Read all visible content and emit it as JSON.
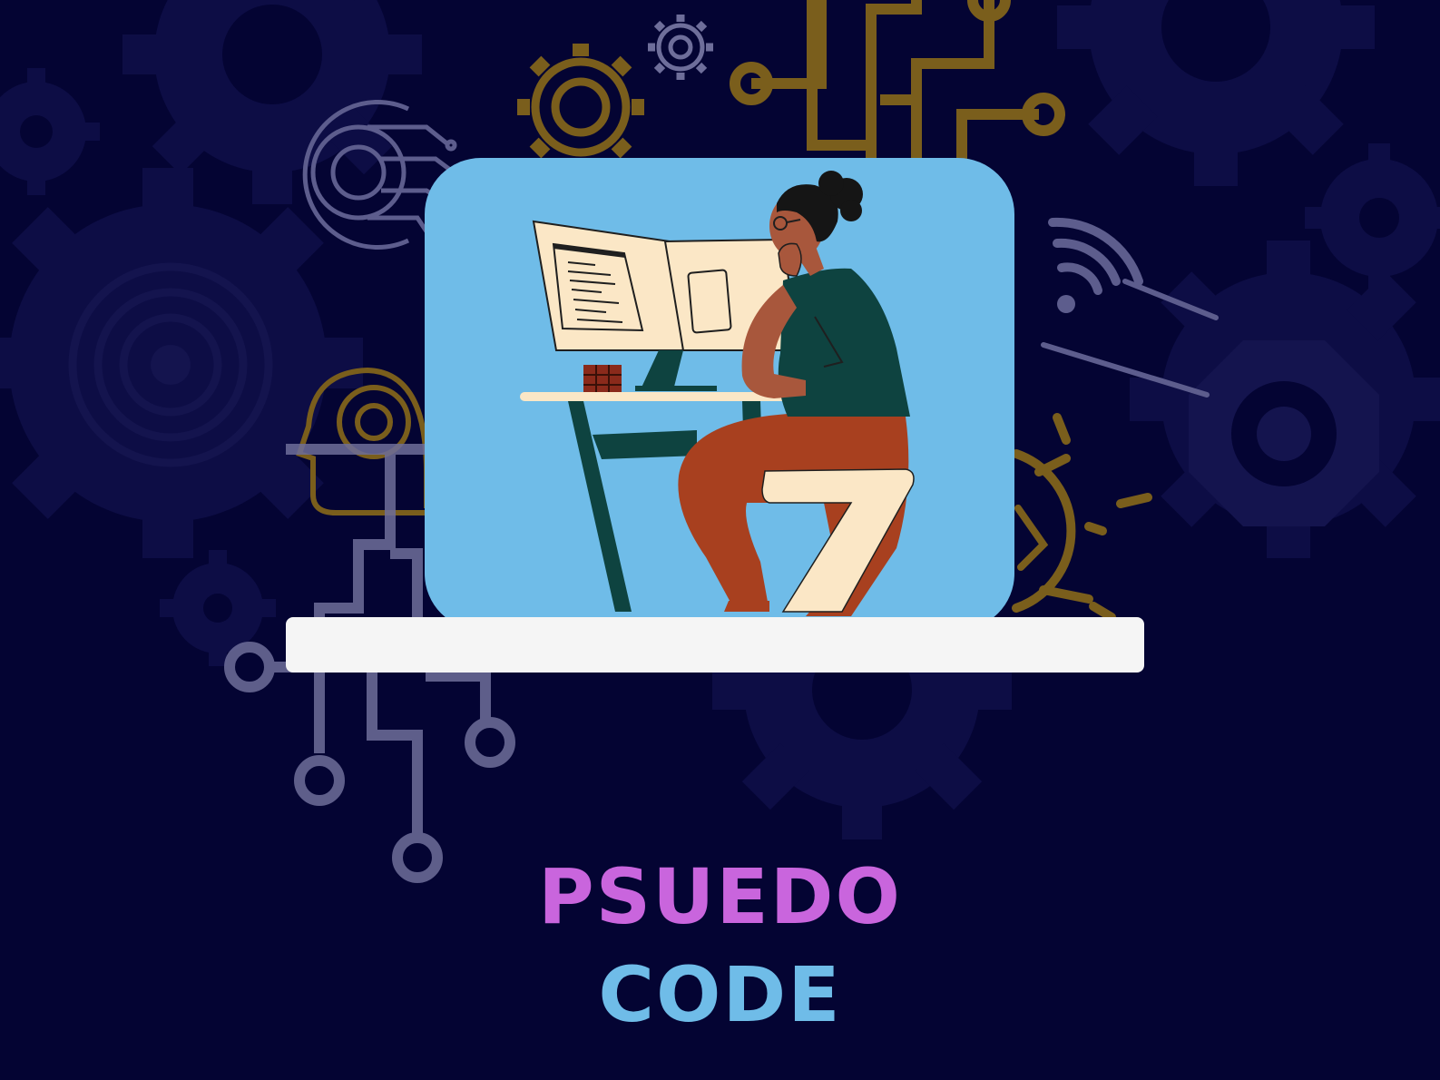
{
  "title": {
    "line1": "PSUEDO",
    "line2": "CODE"
  },
  "colors": {
    "background": "#040433",
    "line1": "#c965dd",
    "line2": "#6fbce8",
    "card": "#6fbce8",
    "shelf": "#f5f5f5",
    "gold": "#7a5e1c",
    "pale_icon": "#6e6e9a"
  },
  "icons": [
    "gear-icon",
    "circuit-icon",
    "ai-brain-head-icon",
    "wifi-icon",
    "lightbulb-gear-icon",
    "target-icon"
  ]
}
